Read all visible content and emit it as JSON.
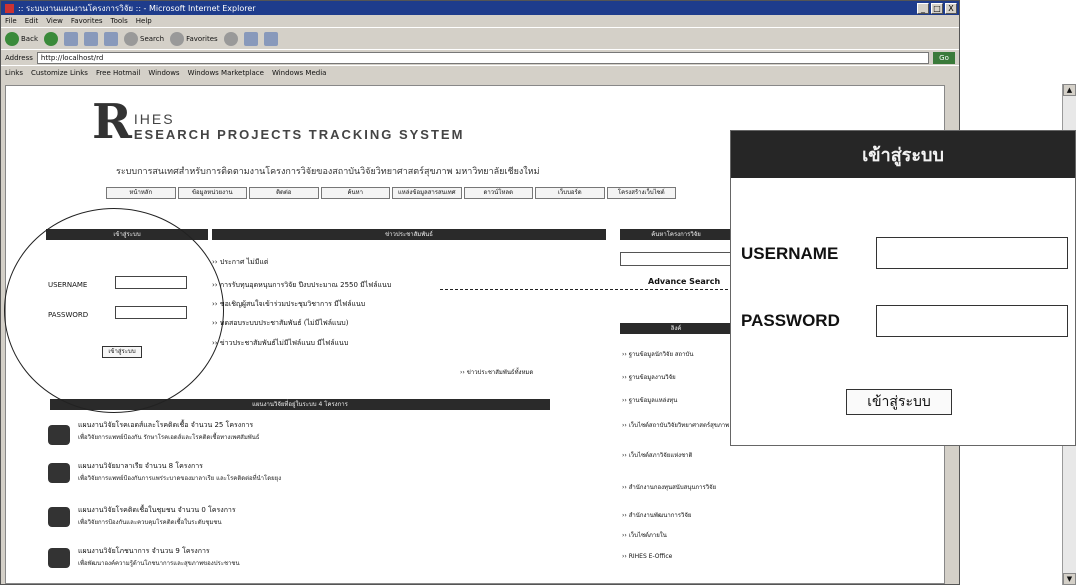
{
  "window": {
    "title": ":: ระบบงานแผนงานโครงการวิจัย :: - Microsoft Internet Explorer",
    "controls": [
      "_",
      "□",
      "X"
    ]
  },
  "menu": [
    "File",
    "Edit",
    "View",
    "Favorites",
    "Tools",
    "Help"
  ],
  "toolbar": {
    "back": "Back",
    "search": "Search",
    "favorites": "Favorites"
  },
  "address": {
    "label": "Address",
    "url": "http://localhost/rd",
    "go": "Go"
  },
  "links": {
    "label": "Links",
    "items": [
      "Customize Links",
      "Free Hotmail",
      "Windows",
      "Windows Marketplace",
      "Windows Media"
    ]
  },
  "site": {
    "logo_letter": "R",
    "logo_line1": "IHES",
    "logo_line2": "ESEARCH PROJECTS TRACKING SYSTEM",
    "subtitle": "ระบบการสนเทศสำหรับการติดตามงานโครงการวิจัยของสถาบันวิจัยวิทยาศาสตร์สุขภาพ มหาวิทยาลัยเชียงใหม่",
    "nav": [
      "หน้าหลัก",
      "ข้อมูลหน่วยงาน",
      "ติดต่อ",
      "ค้นหา",
      "แหล่งข้อมูลสารสนเทศ",
      "ดาวน์โหลด",
      "เว็บบอร์ด",
      "โครงสร้างเว็บไซต์"
    ]
  },
  "login_panel": {
    "header": "เข้าสู่ระบบ",
    "username_label": "USERNAME",
    "password_label": "PASSWORD",
    "button": "เข้าสู่ระบบ"
  },
  "news": {
    "header": "ข่าวประชาสัมพันธ์",
    "items": [
      "ประกาศ ไม่มีแต่",
      "การรับทุนอุดหนุนการวิจัย ปีงบประมาณ 2550 มีไฟล์แนบ",
      "ขอเชิญผู้สนใจเข้าร่วมประชุมวิชาการ มีไฟล์แนบ",
      "ทดสอบระบบประชาสัมพันธ์ (ไม่มีไฟล์แนบ)",
      "ข่าวประชาสัมพันธ์ไม่มีไฟล์แนบ มีไฟล์แนบ"
    ],
    "more": "ข่าวประชาสัมพันธ์ทั้งหมด"
  },
  "search_panel": {
    "header": "ค้นหาโครงการวิจัย",
    "advanced": "Advance Search"
  },
  "links_panel": {
    "header": "ลิงค์",
    "items": [
      "ฐานข้อมูลนักวิจัย สถาบัน",
      "ฐานข้อมูลงานวิจัย",
      "ฐานข้อมูลแหล่งทุน",
      "เว็บไซต์สถาบันวิจัยวิทยาศาสตร์สุขภาพ",
      "เว็บไซต์สภาวิจัยแห่งชาติ",
      "สำนักงานกองทุนสนับสนุนการวิจัย",
      "สำนักงานพัฒนาการวิจัย",
      "เว็บไซต์ภายใน",
      "RIHES E-Office"
    ]
  },
  "projects": {
    "header": "แผนงานวิจัยที่อยู่ในระบบ 4 โครงการ",
    "items": [
      {
        "title": "แผนงานวิจัยโรคเอดส์และโรคติดเชื้อ จำนวน 25 โครงการ",
        "desc": "เพื่อวิจัยการแพทย์ป้องกัน รักษาโรคเอดส์และโรคติดเชื้อทางเพศสัมพันธ์"
      },
      {
        "title": "แผนงานวิจัยมาลาเรีย จำนวน 8 โครงการ",
        "desc": "เพื่อวิจัยการแพทย์ป้องกันการแพร่ระบาดของมาลาเรีย และโรคติดต่อที่นำโดยยุง"
      },
      {
        "title": "แผนงานวิจัยโรคติดเชื้อในชุมชน จำนวน 0 โครงการ",
        "desc": "เพื่อวิจัยการป้องกันและควบคุมโรคติดเชื้อในระดับชุมชน"
      },
      {
        "title": "แผนงานวิจัยโภชนาการ จำนวน 9 โครงการ",
        "desc": "เพื่อพัฒนาองค์ความรู้ด้านโภชนาการและสุขภาพของประชาชน"
      }
    ]
  },
  "zoom": {
    "header": "เข้าสู่ระบบ",
    "username_label": "USERNAME",
    "password_label": "PASSWORD",
    "button": "เข้าสู่ระบบ"
  }
}
